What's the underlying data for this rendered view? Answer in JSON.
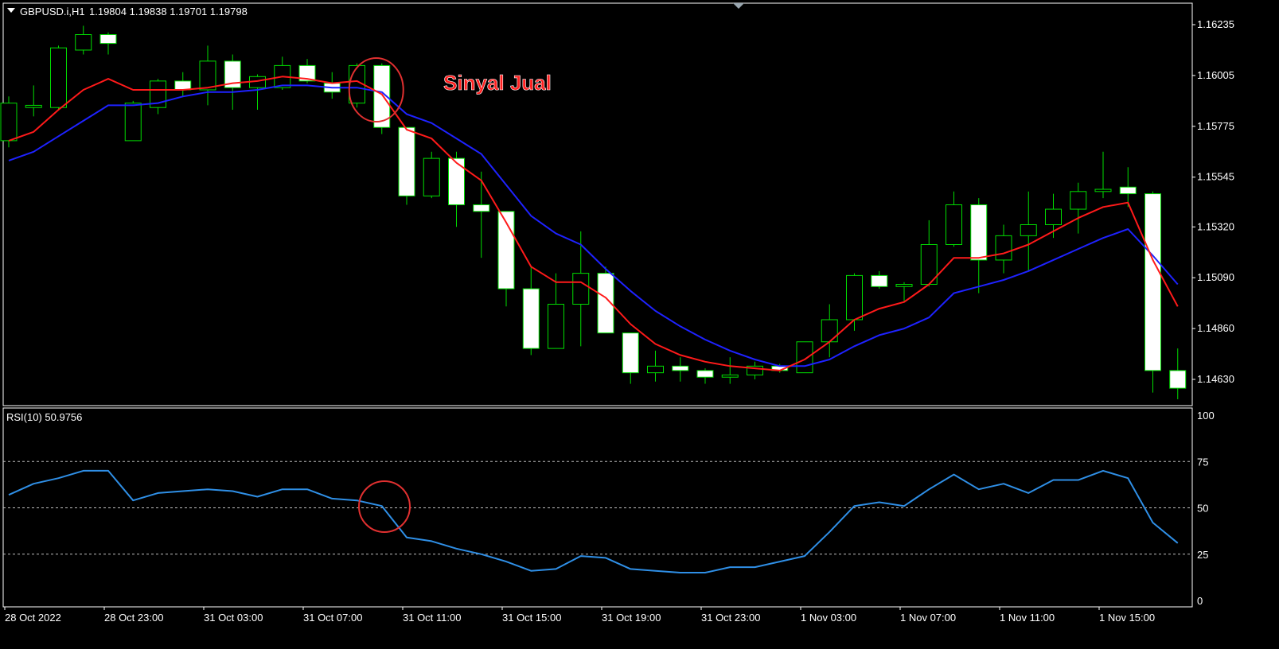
{
  "header": {
    "symbol": "GBPUSD.i,H1",
    "ohlc": "1.19804 1.19838 1.19701 1.19798",
    "rsi_label": "RSI(10) 50.9756"
  },
  "annotation": {
    "text": "Sinyal Jual"
  },
  "colors": {
    "background": "#000000",
    "grid": "#c0c0c0",
    "bull_body": "#000000",
    "bear_body": "#ffffff",
    "wick": "#00dd00",
    "ma_fast": "#ff1a1a",
    "ma_slow": "#1e22ff",
    "rsi_line": "#2f8fe6",
    "circle": "#e03030",
    "annotation_text": "#ff2020"
  },
  "chart_data": [
    {
      "type": "candlestick",
      "title": "GBPUSD.i,H1",
      "price_axis_ticks": [
        "1.16235",
        "1.16005",
        "1.15775",
        "1.15545",
        "1.15320",
        "1.15090",
        "1.14860",
        "1.14630"
      ],
      "ylim": [
        1.1454,
        1.1632
      ],
      "time_axis_ticks": [
        "28 Oct 2022",
        "28 Oct 23:00",
        "31 Oct 03:00",
        "31 Oct 07:00",
        "31 Oct 11:00",
        "31 Oct 15:00",
        "31 Oct 19:00",
        "31 Oct 23:00",
        "1 Nov 03:00",
        "1 Nov 07:00",
        "1 Nov 11:00",
        "1 Nov 15:00"
      ],
      "candles": [
        {
          "o": 1.1571,
          "h": 1.1591,
          "l": 1.1568,
          "c": 1.1588
        },
        {
          "o": 1.1586,
          "h": 1.1596,
          "l": 1.1582,
          "c": 1.1587
        },
        {
          "o": 1.1586,
          "h": 1.1614,
          "l": 1.1585,
          "c": 1.1613
        },
        {
          "o": 1.1612,
          "h": 1.1623,
          "l": 1.161,
          "c": 1.1619
        },
        {
          "o": 1.1619,
          "h": 1.162,
          "l": 1.161,
          "c": 1.1615
        },
        {
          "o": 1.1571,
          "h": 1.1589,
          "l": 1.1571,
          "c": 1.1588
        },
        {
          "o": 1.1586,
          "h": 1.1599,
          "l": 1.1583,
          "c": 1.1598
        },
        {
          "o": 1.1598,
          "h": 1.1602,
          "l": 1.1591,
          "c": 1.1594
        },
        {
          "o": 1.1594,
          "h": 1.1614,
          "l": 1.1587,
          "c": 1.1607
        },
        {
          "o": 1.1607,
          "h": 1.161,
          "l": 1.1585,
          "c": 1.1595
        },
        {
          "o": 1.1595,
          "h": 1.1601,
          "l": 1.1585,
          "c": 1.16
        },
        {
          "o": 1.1595,
          "h": 1.1609,
          "l": 1.1594,
          "c": 1.1605
        },
        {
          "o": 1.1605,
          "h": 1.1608,
          "l": 1.1597,
          "c": 1.1598
        },
        {
          "o": 1.1597,
          "h": 1.1602,
          "l": 1.159,
          "c": 1.1593
        },
        {
          "o": 1.1588,
          "h": 1.1606,
          "l": 1.1586,
          "c": 1.1605
        },
        {
          "o": 1.1605,
          "h": 1.1606,
          "l": 1.1574,
          "c": 1.1577
        },
        {
          "o": 1.1577,
          "h": 1.1577,
          "l": 1.1542,
          "c": 1.1546
        },
        {
          "o": 1.1546,
          "h": 1.1566,
          "l": 1.1545,
          "c": 1.1563
        },
        {
          "o": 1.1563,
          "h": 1.1566,
          "l": 1.1532,
          "c": 1.1542
        },
        {
          "o": 1.1542,
          "h": 1.1557,
          "l": 1.1518,
          "c": 1.1539
        },
        {
          "o": 1.1539,
          "h": 1.1539,
          "l": 1.1496,
          "c": 1.1504
        },
        {
          "o": 1.1504,
          "h": 1.1514,
          "l": 1.1474,
          "c": 1.1477
        },
        {
          "o": 1.1477,
          "h": 1.1511,
          "l": 1.1477,
          "c": 1.1497
        },
        {
          "o": 1.1497,
          "h": 1.153,
          "l": 1.1478,
          "c": 1.1511
        },
        {
          "o": 1.1511,
          "h": 1.1514,
          "l": 1.1484,
          "c": 1.1484
        },
        {
          "o": 1.1484,
          "h": 1.1484,
          "l": 1.1461,
          "c": 1.1466
        },
        {
          "o": 1.1466,
          "h": 1.1476,
          "l": 1.1462,
          "c": 1.1469
        },
        {
          "o": 1.1469,
          "h": 1.1473,
          "l": 1.1462,
          "c": 1.1467
        },
        {
          "o": 1.1467,
          "h": 1.1468,
          "l": 1.1461,
          "c": 1.1464
        },
        {
          "o": 1.1464,
          "h": 1.1473,
          "l": 1.1461,
          "c": 1.1465
        },
        {
          "o": 1.1465,
          "h": 1.1471,
          "l": 1.1463,
          "c": 1.1469
        },
        {
          "o": 1.1469,
          "h": 1.147,
          "l": 1.1466,
          "c": 1.1467
        },
        {
          "o": 1.1466,
          "h": 1.148,
          "l": 1.1466,
          "c": 1.148
        },
        {
          "o": 1.148,
          "h": 1.1497,
          "l": 1.1473,
          "c": 1.149
        },
        {
          "o": 1.149,
          "h": 1.1511,
          "l": 1.1485,
          "c": 1.151
        },
        {
          "o": 1.151,
          "h": 1.1512,
          "l": 1.1504,
          "c": 1.1505
        },
        {
          "o": 1.1505,
          "h": 1.1507,
          "l": 1.1498,
          "c": 1.1506
        },
        {
          "o": 1.1506,
          "h": 1.1535,
          "l": 1.1505,
          "c": 1.1524
        },
        {
          "o": 1.1524,
          "h": 1.1548,
          "l": 1.1523,
          "c": 1.1542
        },
        {
          "o": 1.1542,
          "h": 1.1545,
          "l": 1.1502,
          "c": 1.1517
        },
        {
          "o": 1.1517,
          "h": 1.1533,
          "l": 1.1511,
          "c": 1.1528
        },
        {
          "o": 1.1528,
          "h": 1.1548,
          "l": 1.1512,
          "c": 1.1533
        },
        {
          "o": 1.1533,
          "h": 1.1547,
          "l": 1.1527,
          "c": 1.154
        },
        {
          "o": 1.154,
          "h": 1.1552,
          "l": 1.1529,
          "c": 1.1548
        },
        {
          "o": 1.1548,
          "h": 1.1566,
          "l": 1.1545,
          "c": 1.1549
        },
        {
          "o": 1.155,
          "h": 1.1559,
          "l": 1.1541,
          "c": 1.1547
        },
        {
          "o": 1.1547,
          "h": 1.1548,
          "l": 1.1457,
          "c": 1.1467
        },
        {
          "o": 1.1467,
          "h": 1.1477,
          "l": 1.1454,
          "c": 1.1459
        }
      ],
      "series": [
        {
          "name": "",
          "role": "fast_ma",
          "values": [
            1.1571,
            1.1575,
            1.1585,
            1.1594,
            1.1599,
            1.1594,
            1.1594,
            1.1594,
            1.1595,
            1.1597,
            1.1598,
            1.16,
            1.1599,
            1.1597,
            1.1598,
            1.1592,
            1.1576,
            1.1572,
            1.1561,
            1.1553,
            1.1534,
            1.1514,
            1.1507,
            1.1507,
            1.15,
            1.1488,
            1.1479,
            1.1474,
            1.1471,
            1.1469,
            1.1468,
            1.1467,
            1.1472,
            1.148,
            1.149,
            1.1495,
            1.1498,
            1.1506,
            1.1518,
            1.1518,
            1.152,
            1.1524,
            1.153,
            1.1536,
            1.1541,
            1.1543,
            1.1517,
            1.1496
          ]
        },
        {
          "name": "",
          "role": "slow_ma",
          "values": [
            1.1562,
            1.1566,
            1.1573,
            1.158,
            1.1587,
            1.1587,
            1.1588,
            1.1591,
            1.1593,
            1.1593,
            1.1594,
            1.1596,
            1.1596,
            1.1595,
            1.1595,
            1.1593,
            1.1583,
            1.1579,
            1.1572,
            1.1565,
            1.1551,
            1.1537,
            1.1529,
            1.1524,
            1.1513,
            1.1503,
            1.1494,
            1.1487,
            1.1481,
            1.1476,
            1.1472,
            1.1469,
            1.1469,
            1.1472,
            1.1478,
            1.1483,
            1.1486,
            1.1491,
            1.1502,
            1.1505,
            1.1508,
            1.1512,
            1.1517,
            1.1522,
            1.1527,
            1.1531,
            1.1519,
            1.1506
          ]
        }
      ]
    },
    {
      "type": "line",
      "title": "RSI(10) 50.9756",
      "ylim": [
        0,
        100
      ],
      "y_ticks": [
        "100",
        "75",
        "50",
        "25",
        "0"
      ],
      "levels": [
        75,
        50,
        25
      ],
      "series": [
        {
          "name": "",
          "values": [
            57,
            63,
            66,
            70,
            70,
            54,
            58,
            59,
            60,
            59,
            56,
            60,
            60,
            55,
            54,
            51,
            34,
            32,
            28,
            25,
            21,
            16,
            17,
            24,
            23,
            17,
            16,
            15,
            15,
            18,
            18,
            21,
            24,
            37,
            51,
            53,
            51,
            60,
            68,
            60,
            63,
            58,
            65,
            65,
            70,
            66,
            42,
            31
          ]
        }
      ]
    }
  ]
}
